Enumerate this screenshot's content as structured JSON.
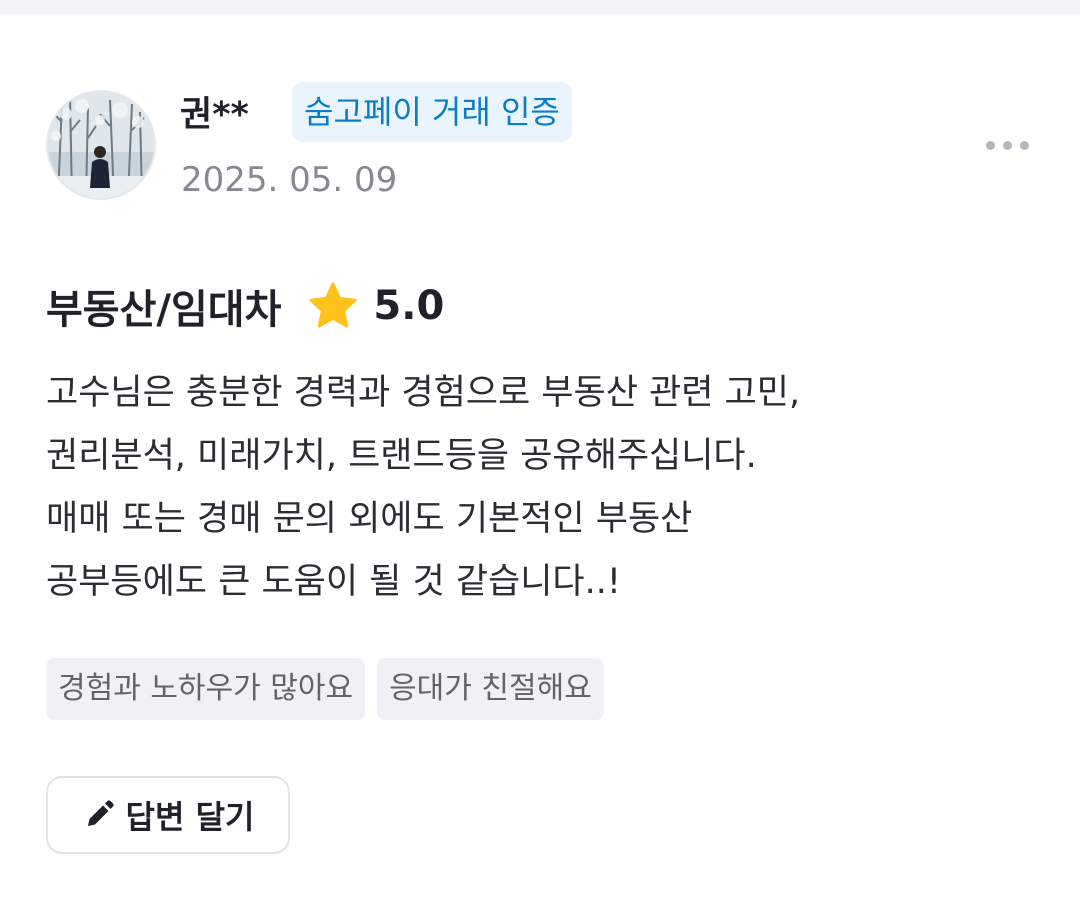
{
  "review": {
    "reviewer_name": "권**",
    "verified_badge": "숨고페이 거래 인증",
    "date": "2025. 05. 09",
    "service": "부동산/임대차",
    "rating": "5.0",
    "body_lines": [
      "고수님은 충분한 경력과 경험으로 부동산 관련 고민,",
      "권리분석, 미래가치, 트랜드등을 공유해주십니다.",
      "매매 또는 경매 문의 외에도 기본적인 부동산",
      "공부등에도 큰 도움이 될 것 같습니다..!"
    ],
    "tags": [
      "경험과 노하우가 많아요",
      "응대가 친절해요"
    ]
  },
  "actions": {
    "reply_label": "답변 달기"
  },
  "icons": {
    "rating": "star-icon",
    "more": "more-dots-icon",
    "reply": "pencil-icon"
  },
  "colors": {
    "badge_text": "#0a7ec5",
    "badge_bg": "#eaf4fe",
    "star": "#ffc21a",
    "muted_text": "#858a91",
    "tag_bg": "#eff1f4"
  }
}
